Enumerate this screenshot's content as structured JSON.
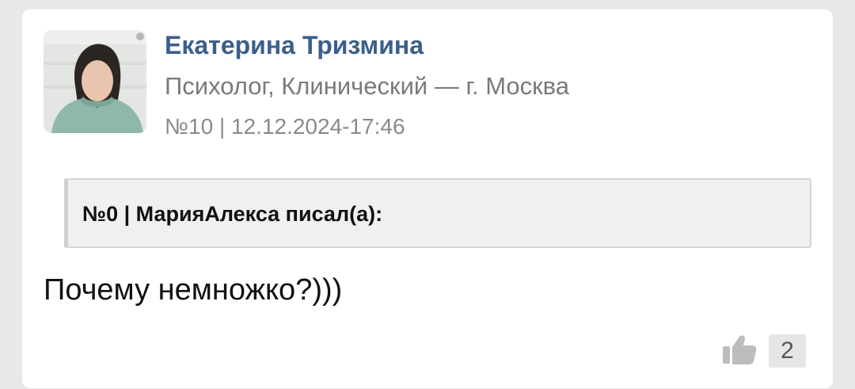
{
  "post": {
    "author_name": "Екатерина Тризмина",
    "author_role": "Психолог, Клинический — г. Москва",
    "meta": "№10 | 12.12.2024-17:46",
    "avatar_icon": "user-photo",
    "quote_header": "№0 | МарияАлекса писал(а):",
    "message": "Почему немножко?)))",
    "like_icon": "thumbs-up-icon",
    "like_count": "2"
  },
  "colors": {
    "author_name": "#3b5f8c",
    "background": "#e8e8e8",
    "card": "#ffffff",
    "quote_bg": "#f0f0f0"
  }
}
